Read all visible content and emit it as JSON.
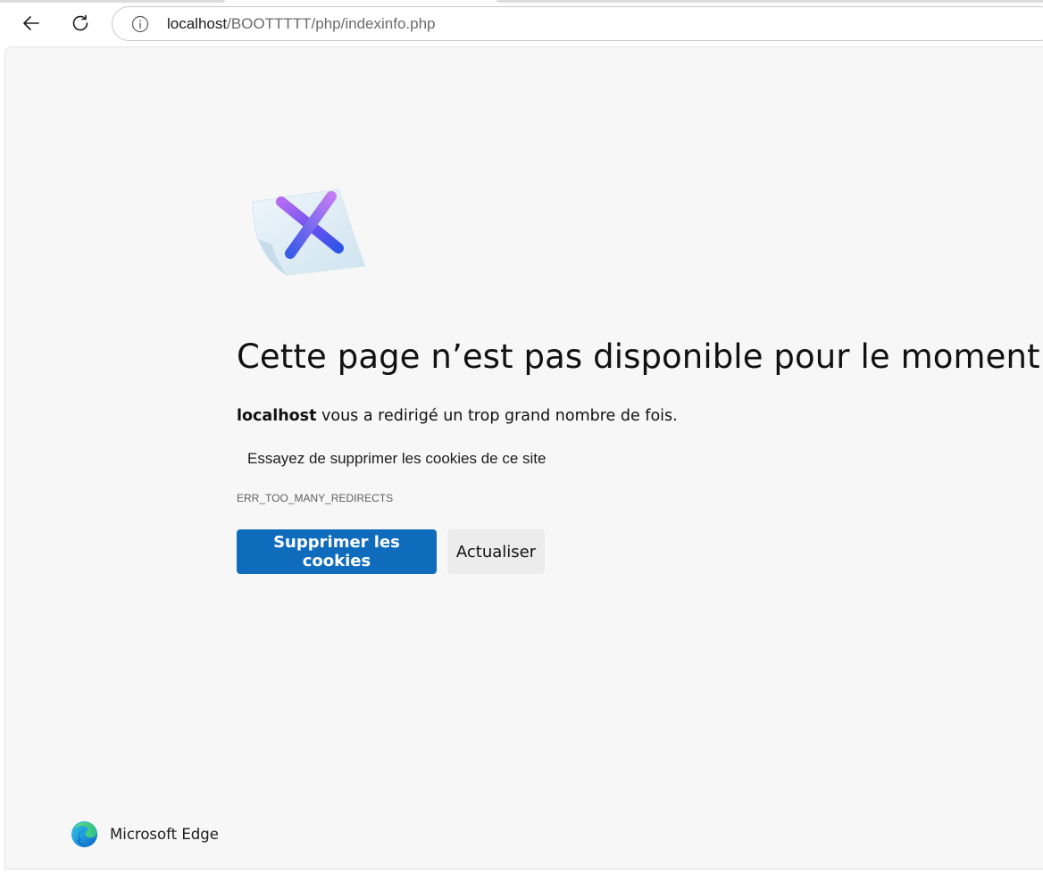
{
  "browser": {
    "url_host": "localhost",
    "url_path": "/BOOTTTTT/php/indexinfo.php"
  },
  "error_page": {
    "headline": "Cette page n’est pas disponible pour le moment",
    "explanation_host": "localhost",
    "explanation_text": " vous a redirigé un trop grand nombre de fois.",
    "suggestion": "Essayez de supprimer les cookies de ce site",
    "error_code": "ERR_TOO_MANY_REDIRECTS",
    "primary_button": "Supprimer les cookies",
    "secondary_button": "Actualiser"
  },
  "footer": {
    "brand_name": "Microsoft Edge"
  },
  "icons": {
    "back": "back-arrow-icon",
    "refresh": "refresh-icon",
    "info": "info-icon",
    "error": "error-x-icon",
    "brand": "edge-logo-icon"
  },
  "colors": {
    "primary": "#0f6cbd",
    "page_background": "#f7f7f7"
  }
}
